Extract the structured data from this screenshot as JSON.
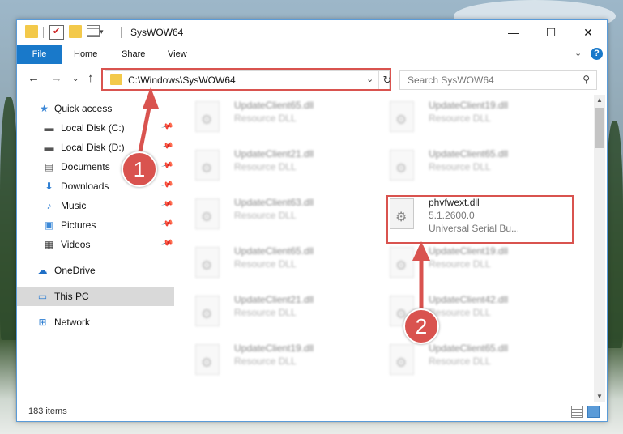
{
  "window": {
    "title": "SysWOW64"
  },
  "ribbon": {
    "file": "File",
    "tabs": [
      "Home",
      "Share",
      "View"
    ]
  },
  "address": {
    "path": "C:\\Windows\\SysWOW64",
    "search_placeholder": "Search SysWOW64"
  },
  "sidebar": {
    "items": [
      {
        "label": "Quick access",
        "icon": "star-icon"
      },
      {
        "label": "Local Disk (C:)",
        "icon": "drive-icon",
        "pinned": true
      },
      {
        "label": "Local Disk (D:)",
        "icon": "drive-icon",
        "pinned": true
      },
      {
        "label": "Documents",
        "icon": "documents-icon",
        "pinned": true
      },
      {
        "label": "Downloads",
        "icon": "download-icon",
        "pinned": true
      },
      {
        "label": "Music",
        "icon": "music-icon",
        "pinned": true
      },
      {
        "label": "Pictures",
        "icon": "pictures-icon",
        "pinned": true
      },
      {
        "label": "Videos",
        "icon": "videos-icon",
        "pinned": true
      },
      {
        "label": "OneDrive",
        "icon": "cloud-icon"
      },
      {
        "label": "This PC",
        "icon": "computer-icon",
        "selected": true
      },
      {
        "label": "Network",
        "icon": "network-icon"
      }
    ]
  },
  "files": [
    {
      "name": "UpdateClient65.dll",
      "desc": "Resource DLL"
    },
    {
      "name": "UpdateClient19.dll",
      "desc": "Resource DLL"
    },
    {
      "name": "UpdateClient21.dll",
      "desc": "Resource DLL"
    },
    {
      "name": "UpdateClient65.dll",
      "desc": "Resource DLL"
    },
    {
      "name": "UpdateClient63.dll",
      "desc": "Resource DLL"
    },
    {
      "name": "phvfwext.dll",
      "version": "5.1.2600.0",
      "desc": "Universal Serial Bu...",
      "highlighted": true
    },
    {
      "name": "UpdateClient65.dll",
      "desc": "Resource DLL"
    },
    {
      "name": "UpdateClient19.dll",
      "desc": "Resource DLL"
    },
    {
      "name": "UpdateClient21.dll",
      "desc": "Resource DLL"
    },
    {
      "name": "UpdateClient42.dll",
      "desc": "Resource DLL"
    },
    {
      "name": "UpdateClient19.dll",
      "desc": "Resource DLL"
    },
    {
      "name": "UpdateClient65.dll",
      "desc": "Resource DLL"
    }
  ],
  "status": {
    "item_count": "183 items"
  },
  "callouts": [
    "1",
    "2"
  ],
  "colors": {
    "accent": "#1979ca",
    "highlight": "#d9534f"
  }
}
